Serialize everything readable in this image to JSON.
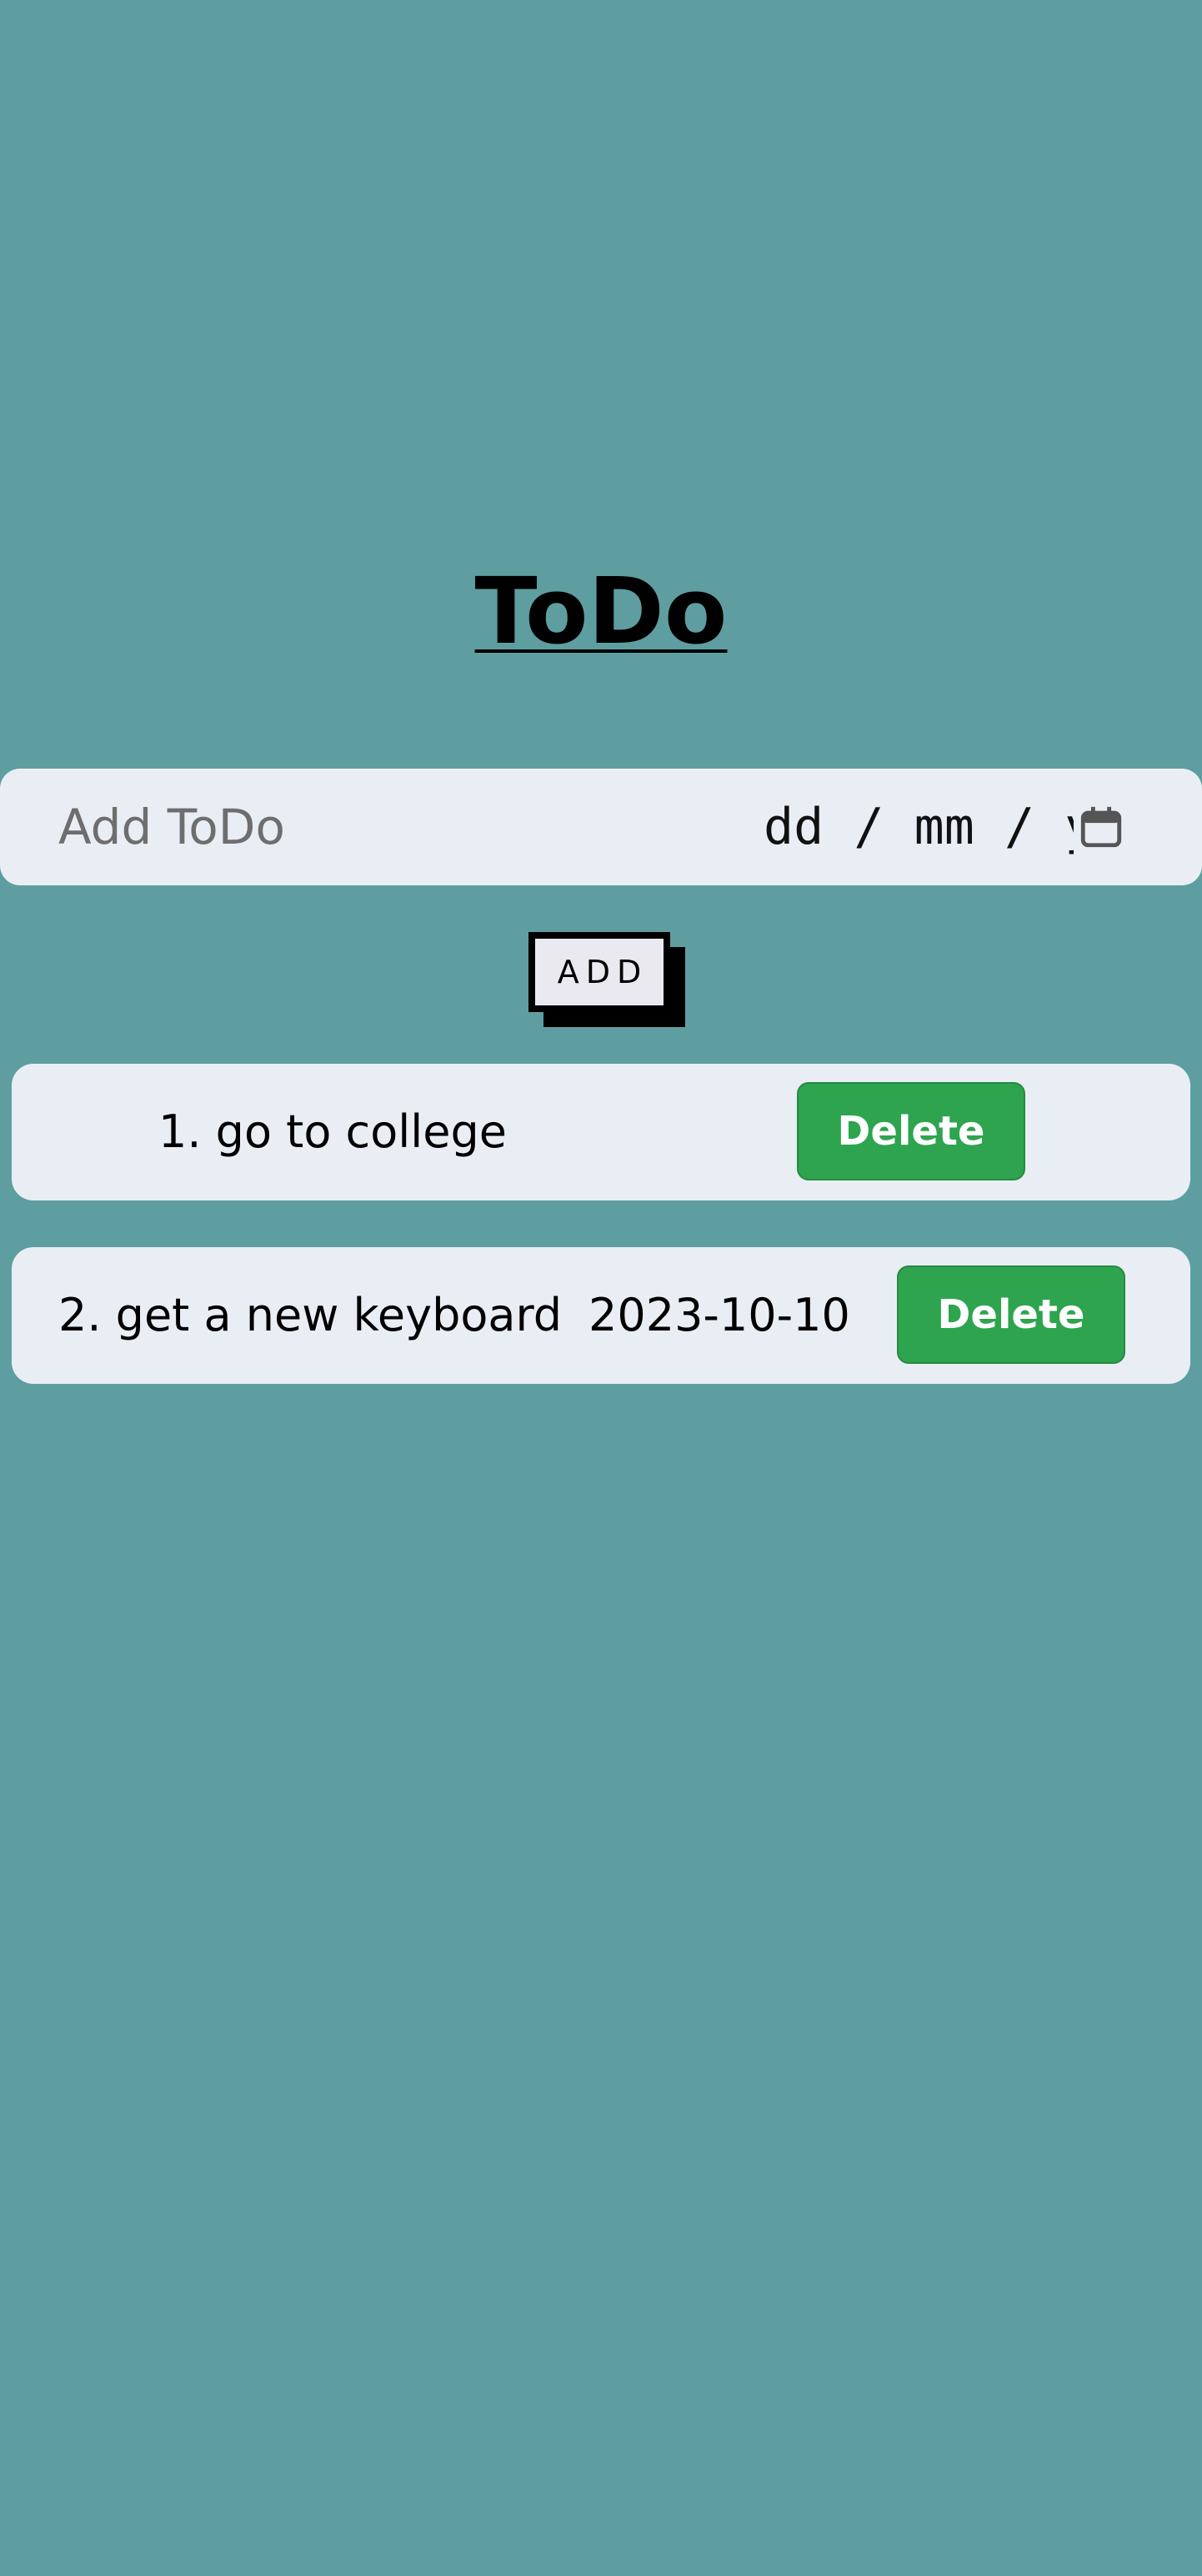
{
  "title": "ToDo",
  "input": {
    "placeholder": "Add ToDo",
    "value": "",
    "date_display": "dd / mm / yyyy"
  },
  "add_button": {
    "label": "ADD"
  },
  "todos": [
    {
      "text": "1. go to college",
      "date": "",
      "delete_label": "Delete"
    },
    {
      "text": "2. get a new keyboard",
      "date": "2023-10-10",
      "delete_label": "Delete"
    }
  ],
  "colors": {
    "background": "#5f9ea0",
    "card": "#e9eef5",
    "delete_button": "#2ea44f"
  }
}
